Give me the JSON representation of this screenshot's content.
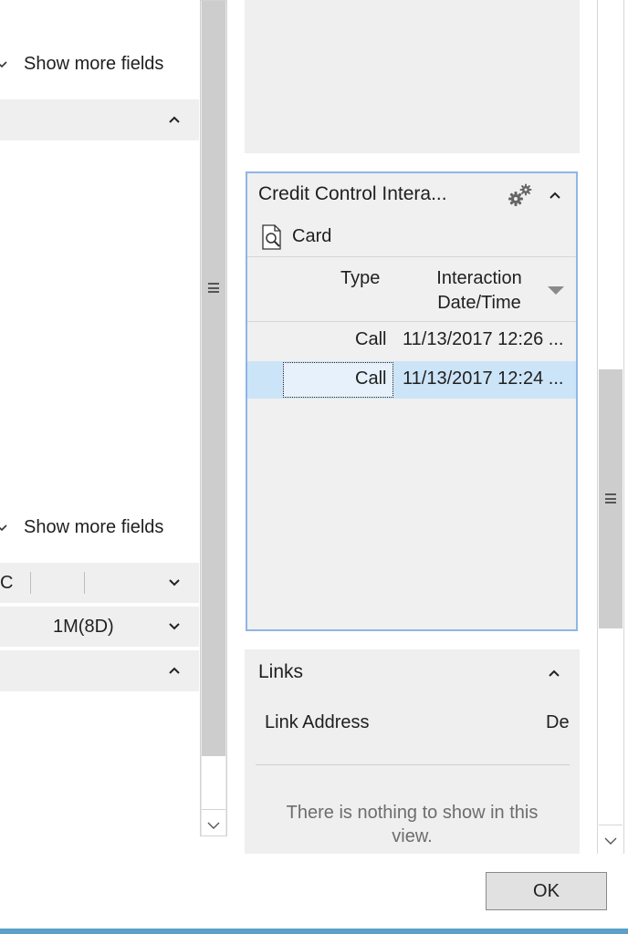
{
  "left": {
    "show_more_fields_top": "Show more fields",
    "show_more_fields_bottom": "Show more fields",
    "filter_row_char": "C",
    "period_value": "1M(8D)"
  },
  "credit_panel": {
    "title": "Credit Control Intera...",
    "card_label": "Card",
    "columns": [
      "Type",
      "Interaction\nDate/Time"
    ],
    "col_type": "Type",
    "col_interaction_line1": "Interaction",
    "col_interaction_line2": "Date/Time",
    "rows": [
      {
        "type": "Call",
        "datetime": "11/13/2017 12:26 ..."
      },
      {
        "type": "Call",
        "datetime": "11/13/2017 12:24 ..."
      }
    ]
  },
  "links_panel": {
    "title": "Links",
    "col_link_address": "Link Address",
    "col_description": "De",
    "empty_message_line1": "There is nothing to show in this",
    "empty_message_line2": "view."
  },
  "dialog": {
    "ok_label": "OK"
  },
  "colors": {
    "accent_border": "#8fb6e6",
    "selected_row": "#cce4f7",
    "panel_bg": "#efefef"
  }
}
